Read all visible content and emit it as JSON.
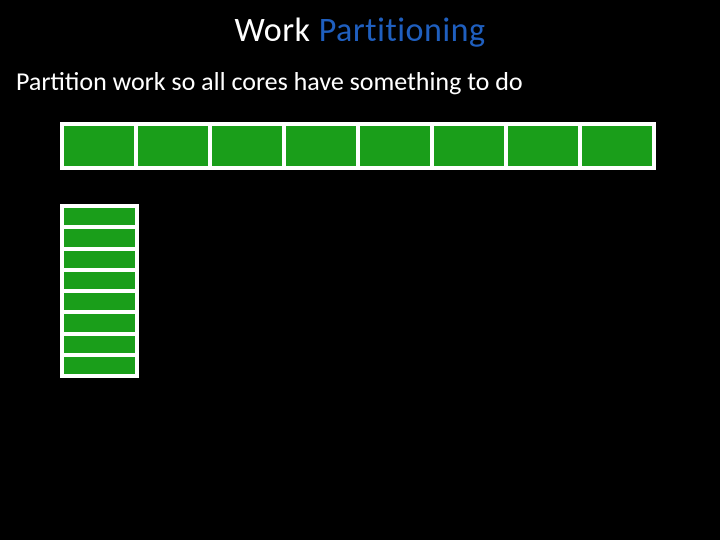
{
  "title_prefix": "Work",
  "title_accent": " Partitioning",
  "subtitle": "Partition work so all cores have something to do",
  "diagram": {
    "horizontal_cells": 8,
    "vertical_cells": 8,
    "cell_color": "#1a9e1a",
    "border_color": "#ffffff"
  }
}
